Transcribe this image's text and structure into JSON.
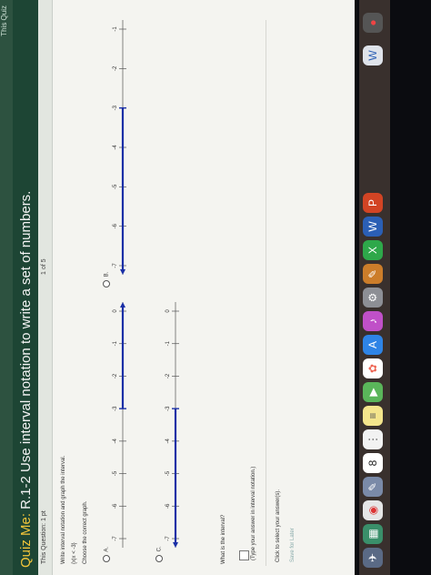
{
  "window": {
    "brand": "Quiz Me:",
    "title": "Quiz Me: R.1-2 Use interval notation to write a set of numbers.",
    "this_quiz": "This Quiz"
  },
  "question_bar": {
    "meta": "This Question: 1 pt",
    "pager": "1 of 5"
  },
  "question": {
    "prompt": "Write interval notation and graph the interval.",
    "set_expression": "{x|x < -3}",
    "choose_label": "Choose the correct graph.",
    "options": [
      {
        "label": "A.",
        "ticks": [
          "-7",
          "-6",
          "-5",
          "-4",
          "-3",
          "-2",
          "-1",
          "0"
        ]
      },
      {
        "label": "B.",
        "ticks": [
          "-7",
          "-6",
          "-5",
          "-4",
          "-3",
          "-2",
          "-1"
        ]
      },
      {
        "label": "C.",
        "ticks": [
          "-7",
          "-6",
          "-5",
          "-4",
          "-3",
          "-2",
          "-1",
          "0"
        ]
      }
    ],
    "interval_question": "What is the interval?",
    "hint": "(Type your answer in interval notation.)"
  },
  "footer": {
    "select_text": "Click to select your answer(s).",
    "save_button": "Save for Later"
  },
  "dock": {
    "calendar_day": "8"
  },
  "colors": {
    "titlebar": "#1d4534",
    "brand": "#f0c43a",
    "graph_line": "#1a2fa6"
  }
}
